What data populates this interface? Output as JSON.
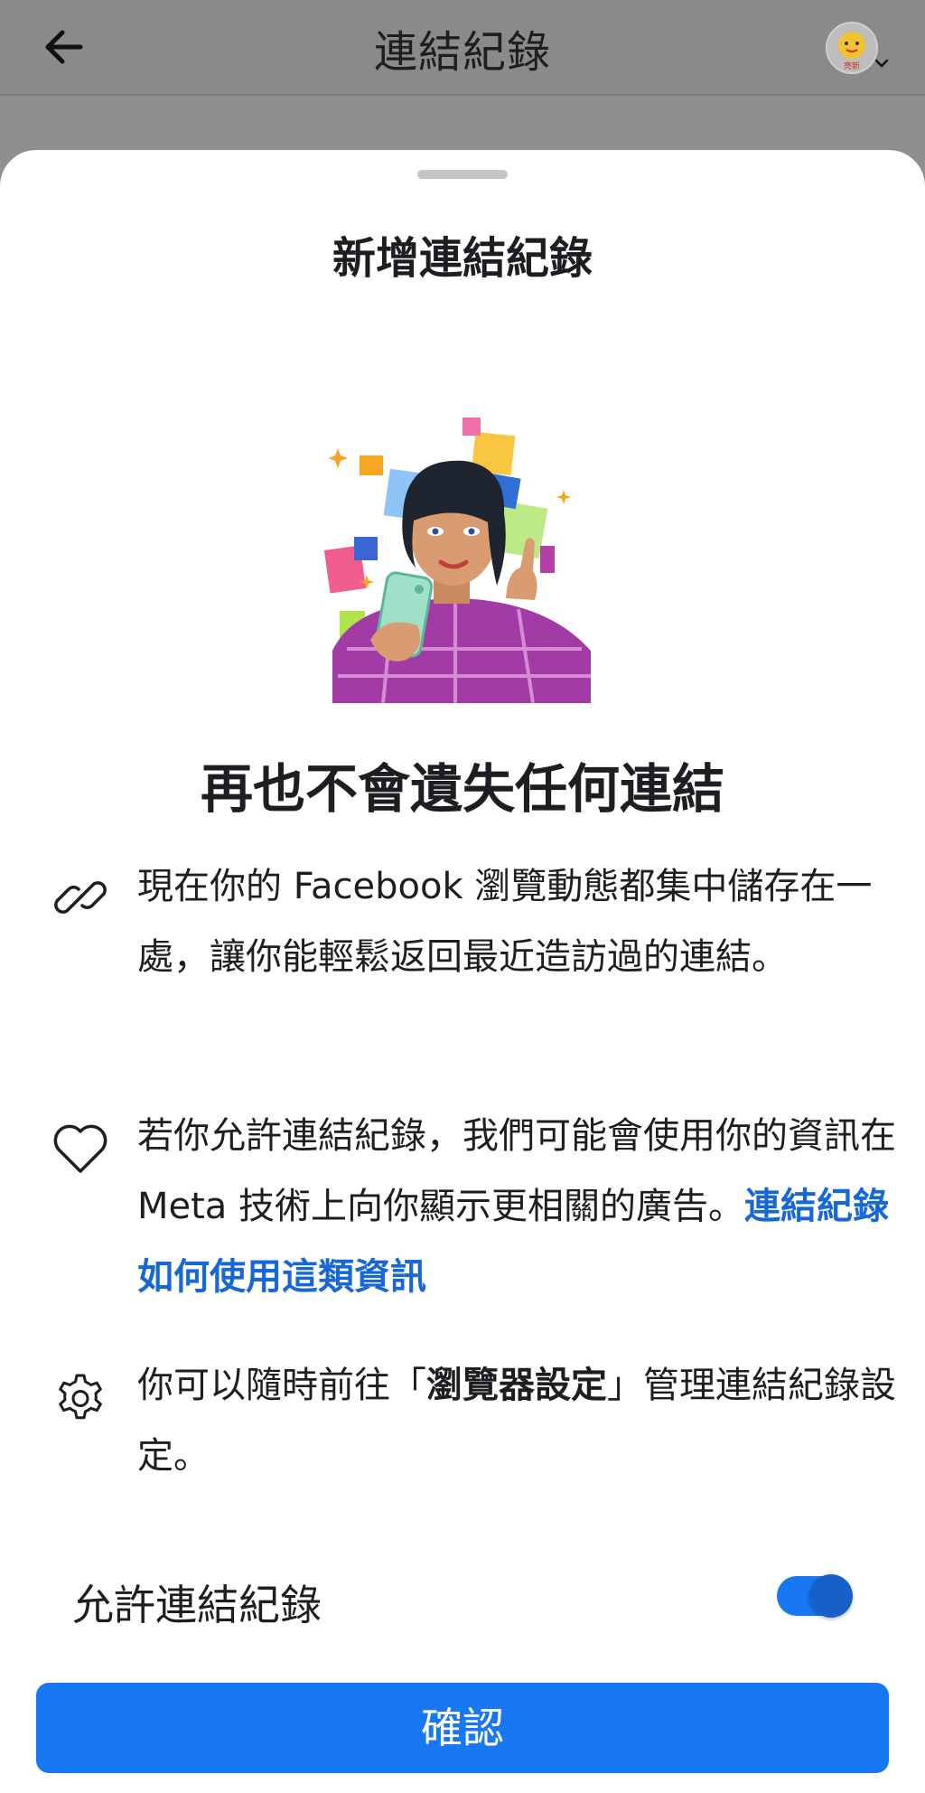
{
  "header": {
    "title": "連結紀錄",
    "back_icon": "arrow-left-icon",
    "avatar_label": "亮新"
  },
  "sheet": {
    "title": "新增連結紀錄",
    "headline": "再也不會遺失任何連結",
    "items": [
      {
        "icon": "link-icon",
        "text": "現在你的 Facebook 瀏覽動態都集中儲存在一處，讓你能輕鬆返回最近造訪過的連結。"
      },
      {
        "icon": "heart-icon",
        "text": "若你允許連結紀錄，我們可能會使用你的資訊在 Meta 技術上向你顯示更相關的廣告。",
        "link": "連結紀錄如何使用這類資訊"
      },
      {
        "icon": "gear-icon",
        "text_before": "你可以隨時前往「",
        "bold": "瀏覽器設定",
        "text_after": "」管理連結紀錄設定。"
      }
    ],
    "toggle": {
      "label": "允許連結紀錄",
      "on": true
    },
    "confirm_label": "確認"
  },
  "colors": {
    "accent": "#1877f2",
    "link": "#1768d6",
    "overlay": "#8f8f8f"
  }
}
